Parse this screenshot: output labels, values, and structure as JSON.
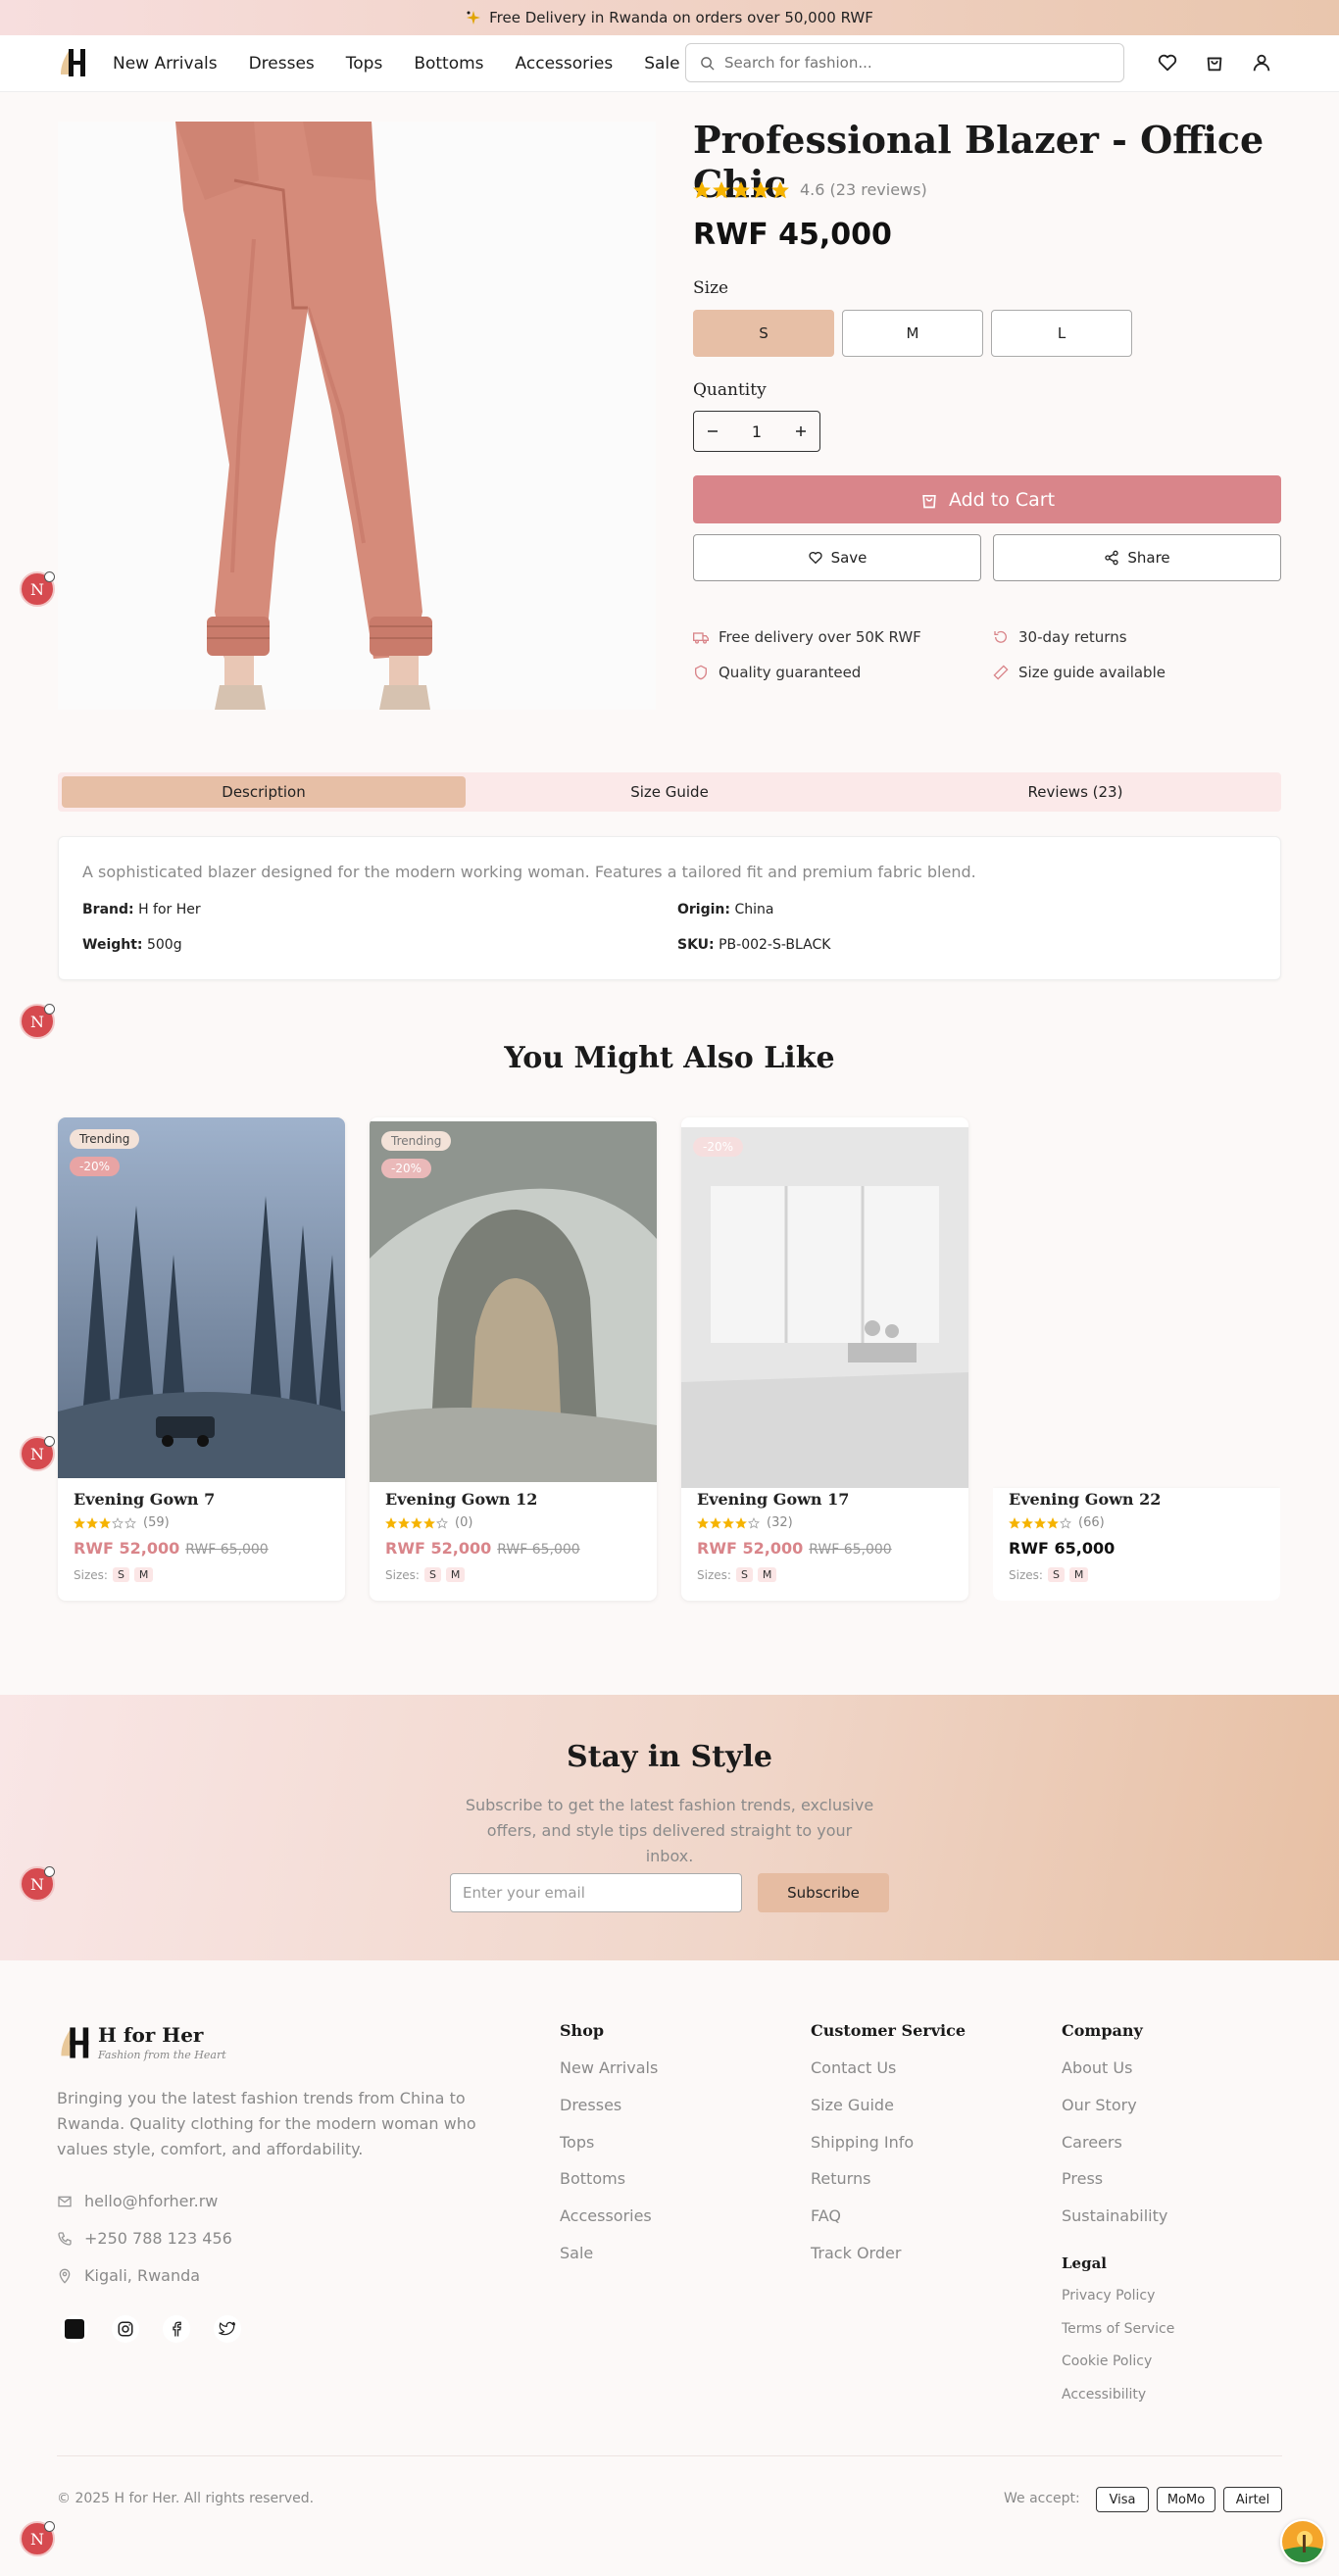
{
  "banner": {
    "icon": "sparkle-icon",
    "text": "Free Delivery in Rwanda on orders over 50,000 RWF"
  },
  "header": {
    "logo": "H",
    "nav": [
      "New Arrivals",
      "Dresses",
      "Tops",
      "Bottoms",
      "Accessories",
      "Sale"
    ],
    "search_placeholder": "Search for fashion...",
    "icons": [
      "heart-icon",
      "cart-icon",
      "user-icon"
    ]
  },
  "product": {
    "title": "Professional Blazer - Office Chic",
    "rating": 4.6,
    "rating_text": "4.6 (23 reviews)",
    "price": "RWF 45,000",
    "size_label": "Size",
    "sizes": [
      "S",
      "M",
      "L"
    ],
    "selected_size": "S",
    "quantity_label": "Quantity",
    "quantity": "1",
    "add_to_cart": "Add to Cart",
    "save": "Save",
    "share": "Share",
    "features": [
      "Free delivery over 50K RWF",
      "30-day returns",
      "Quality guaranteed",
      "Size guide available"
    ]
  },
  "tabs": [
    "Description",
    "Size Guide",
    "Reviews (23)"
  ],
  "active_tab": "Description",
  "description": {
    "text": "A sophisticated blazer designed for the modern working woman. Features a tailored fit and premium fabric blend.",
    "brand_label": "Brand:",
    "brand": "H for Her",
    "origin_label": "Origin:",
    "origin": "China",
    "weight_label": "Weight:",
    "weight": "500g",
    "sku_label": "SKU:",
    "sku": "PB-002-S-BLACK"
  },
  "recommendations": {
    "title": "You Might Also Like",
    "items": [
      {
        "name": "Evening Gown 7",
        "rating": 3,
        "reviews": "(59)",
        "price": "RWF 52,000",
        "old_price": "RWF 65,000",
        "badge": "Trending",
        "discount": "-20%",
        "sizes_label": "Sizes:",
        "sizes": [
          "S",
          "M"
        ]
      },
      {
        "name": "Evening Gown 12",
        "rating": 4,
        "reviews": "(0)",
        "price": "RWF 52,000",
        "old_price": "RWF 65,000",
        "badge": "Trending",
        "discount": "-20%",
        "sizes_label": "Sizes:",
        "sizes": [
          "S",
          "M"
        ]
      },
      {
        "name": "Evening Gown 17",
        "rating": 4,
        "reviews": "(32)",
        "price": "RWF 52,000",
        "old_price": "RWF 65,000",
        "badge": "",
        "discount": "-20%",
        "sizes_label": "Sizes:",
        "sizes": [
          "S",
          "M"
        ]
      },
      {
        "name": "Evening Gown 22",
        "rating": 4,
        "reviews": "(66)",
        "price": "RWF 65,000",
        "old_price": "",
        "badge": "",
        "discount": "",
        "sizes_label": "Sizes:",
        "sizes": [
          "S",
          "M"
        ]
      }
    ]
  },
  "newsletter": {
    "title": "Stay in Style",
    "text": "Subscribe to get the latest fashion trends, exclusive offers, and style tips delivered straight to your inbox.",
    "placeholder": "Enter your email",
    "button": "Subscribe"
  },
  "footer": {
    "brand": "H for Her",
    "tagline": "Fashion from the Heart",
    "about": "Bringing you the latest fashion trends from China to Rwanda. Quality clothing for the modern woman who values style, comfort, and affordability.",
    "email": "hello@hforher.rw",
    "phone": "+250 788 123 456",
    "location": "Kigali, Rwanda",
    "shop_title": "Shop",
    "shop": [
      "New Arrivals",
      "Dresses",
      "Tops",
      "Bottoms",
      "Accessories",
      "Sale"
    ],
    "service_title": "Customer Service",
    "service": [
      "Contact Us",
      "Size Guide",
      "Shipping Info",
      "Returns",
      "FAQ",
      "Track Order"
    ],
    "company_title": "Company",
    "company": [
      "About Us",
      "Our Story",
      "Careers",
      "Press",
      "Sustainability"
    ],
    "legal_title": "Legal",
    "legal": [
      "Privacy Policy",
      "Terms of Service",
      "Cookie Policy",
      "Accessibility"
    ],
    "copyright": "© 2025 H for Her. All rights reserved.",
    "we_accept": "We accept:",
    "payments": [
      "Visa",
      "MoMo",
      "Airtel"
    ]
  },
  "floating_badge": "N",
  "colors": {
    "accent": "#d9858a",
    "beige": "#e7bfa6",
    "pink_bg": "#fbe9e9",
    "star": "#f5b301"
  }
}
